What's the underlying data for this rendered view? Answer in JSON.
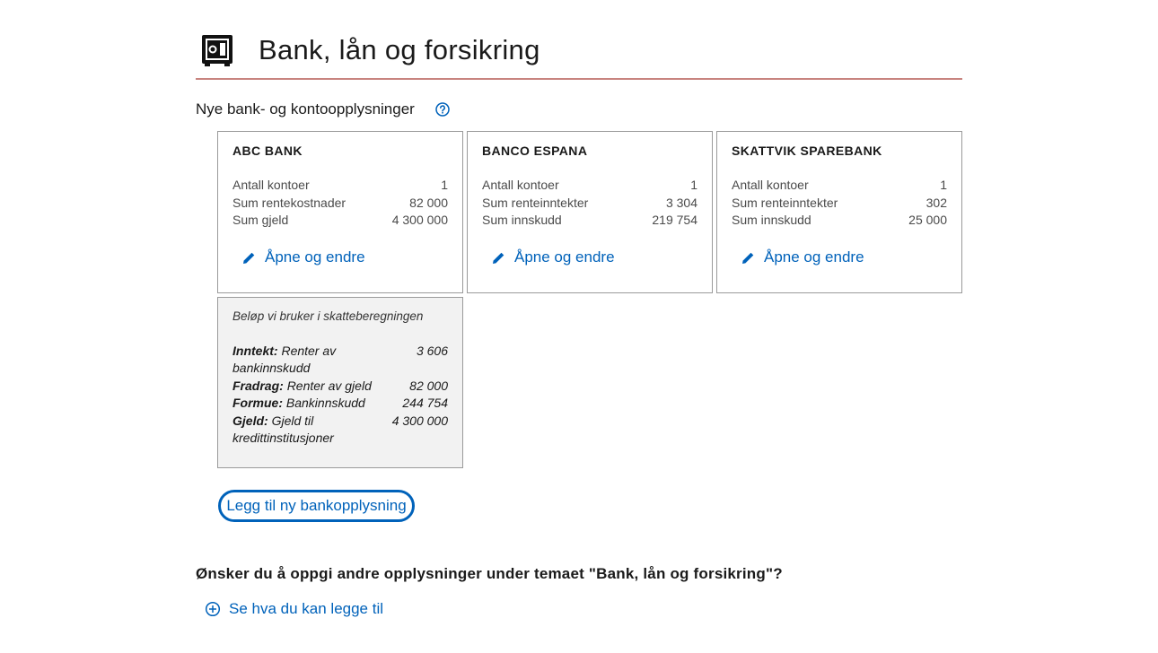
{
  "page": {
    "title": "Bank, lån og forsikring",
    "icon": "safe-icon",
    "accent_color": "#0062ba",
    "rule_color": "#c8847f"
  },
  "section": {
    "label": "Nye bank- og kontoopplysninger",
    "help_icon": "question-circle-icon"
  },
  "banks": [
    {
      "name": "ABC BANK",
      "rows": [
        {
          "label": "Antall kontoer",
          "value": "1"
        },
        {
          "label": "Sum rentekostnader",
          "value": "82 000"
        },
        {
          "label": "Sum gjeld",
          "value": "4 300 000"
        }
      ],
      "edit_label": "Åpne og endre"
    },
    {
      "name": "BANCO ESPANA",
      "rows": [
        {
          "label": "Antall kontoer",
          "value": "1"
        },
        {
          "label": "Sum renteinntekter",
          "value": "3 304"
        },
        {
          "label": "Sum innskudd",
          "value": "219 754"
        }
      ],
      "edit_label": "Åpne og endre"
    },
    {
      "name": "SKATTVIK SPAREBANK",
      "rows": [
        {
          "label": "Antall kontoer",
          "value": "1"
        },
        {
          "label": "Sum renteinntekter",
          "value": "302"
        },
        {
          "label": "Sum innskudd",
          "value": "25 000"
        }
      ],
      "edit_label": "Åpne og endre"
    }
  ],
  "tax": {
    "caption": "Beløp vi bruker i skatteberegningen",
    "rows": [
      {
        "key": "Inntekt:",
        "text": "Renter av bankinnskudd",
        "value": "3 606"
      },
      {
        "key": "Fradrag:",
        "text": "Renter av gjeld",
        "value": "82 000"
      },
      {
        "key": "Formue:",
        "text": "Bankinnskudd",
        "value": "244 754"
      },
      {
        "key": "Gjeld:",
        "text": "Gjeld til kredittinstitusjoner",
        "value": "4 300 000"
      }
    ]
  },
  "add_button_label": "Legg til ny bankopplysning",
  "question": "Ønsker du å oppgi andre opplysninger under temaet \"Bank, lån og forsikring\"?",
  "see_more_label": "Se hva du kan legge til"
}
